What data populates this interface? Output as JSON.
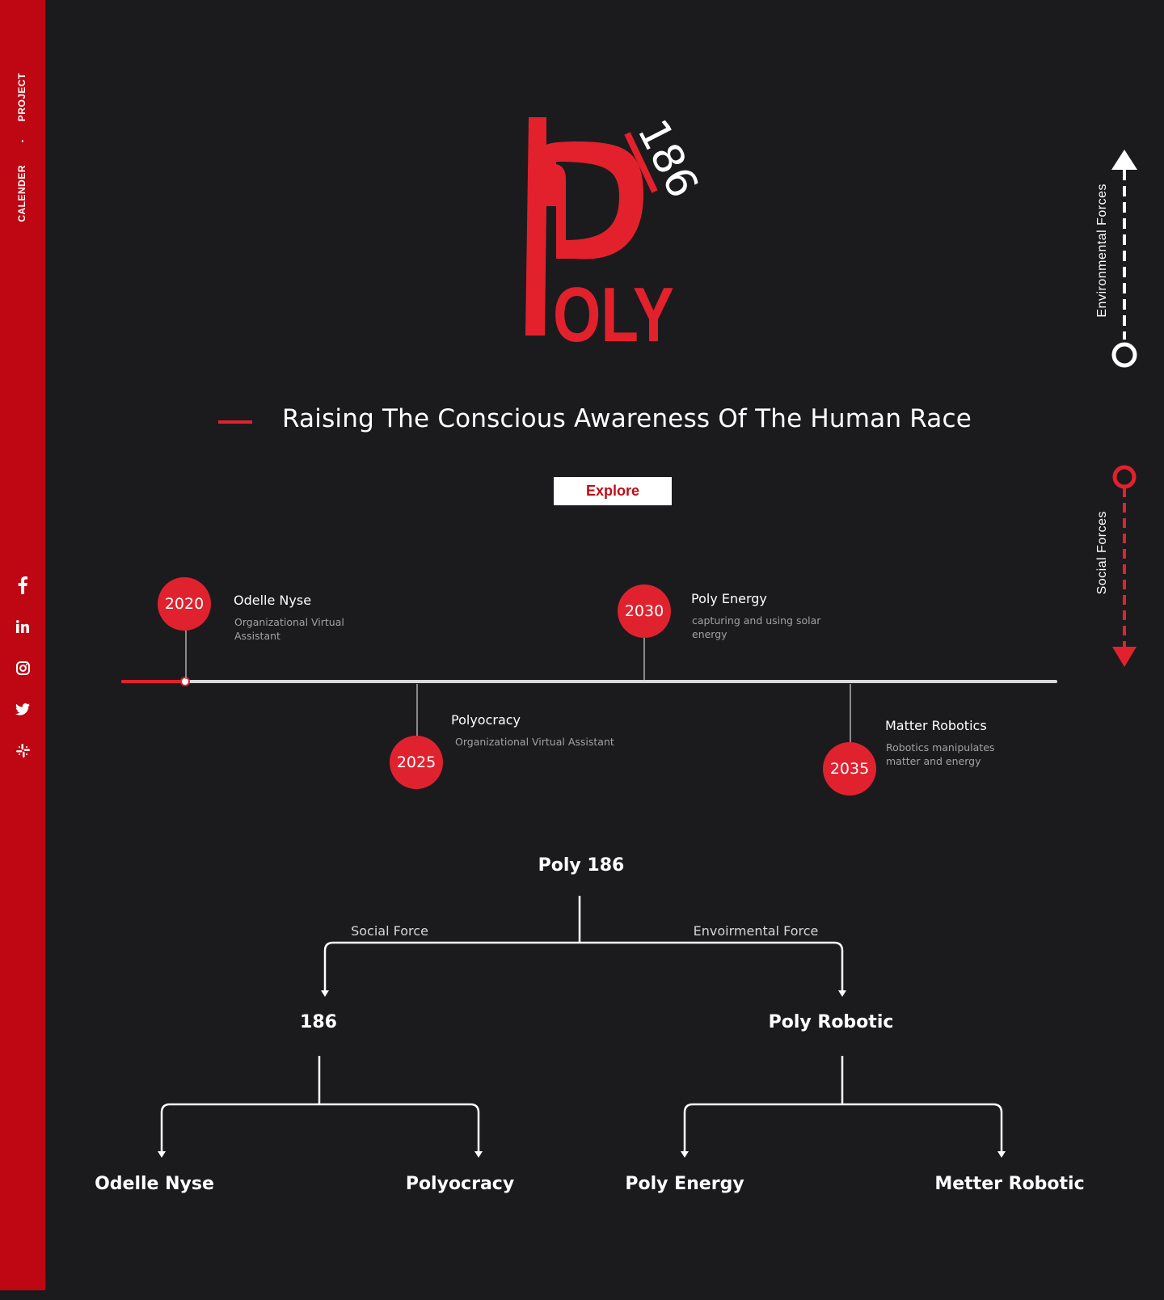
{
  "sidebar": {
    "nav": {
      "project": "PROJECT",
      "separator": "-",
      "calender": "CALENDER"
    },
    "social_icons": [
      "facebook-icon",
      "linkedin-icon",
      "instagram-icon",
      "twitter-icon",
      "slack-icon"
    ]
  },
  "logo": {
    "letter": "P",
    "word": "OLY",
    "number": "186"
  },
  "hero": {
    "tagline": "Raising The Conscious Awareness Of The Human Race",
    "explore_label": "Explore"
  },
  "indicators": {
    "environmental": "Environmental  Forces",
    "social": "Social  Forces"
  },
  "timeline": {
    "events": [
      {
        "year": "2020",
        "title": "Odelle Nyse",
        "desc": "Organizational Virtual Assistant"
      },
      {
        "year": "2025",
        "title": "Polyocracy",
        "desc": "Organizational Virtual Assistant"
      },
      {
        "year": "2030",
        "title": "Poly Energy",
        "desc": "capturing and using solar energy"
      },
      {
        "year": "2035",
        "title": "Matter Robotics",
        "desc": "Robotics manipulates matter and energy"
      }
    ]
  },
  "tree": {
    "root": "Poly 186",
    "left_branch_label": "Social Force",
    "right_branch_label": "Envoirmental Force",
    "left": {
      "name": "186",
      "children": [
        "Odelle Nyse",
        "Polyocracy"
      ]
    },
    "right": {
      "name": "Poly Robotic",
      "children": [
        "Poly Energy",
        "Metter Robotic"
      ]
    }
  },
  "colors": {
    "accent": "#e3212d",
    "sidebar": "#be0713",
    "background": "#1b1b1d"
  }
}
